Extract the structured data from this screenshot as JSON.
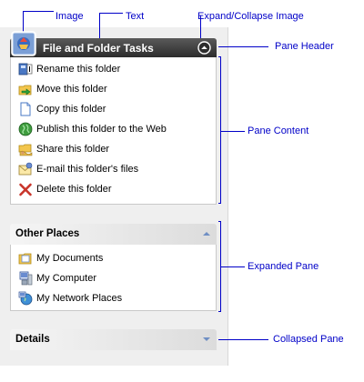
{
  "annotations": {
    "image": "Image",
    "text": "Text",
    "expand_collapse_image": "Expand/Collapse Image",
    "pane_header": "Pane Header",
    "pane_content": "Pane Content",
    "expanded_pane": "Expanded Pane",
    "collapsed_pane": "Collapsed Pane"
  },
  "panes": [
    {
      "title": "File and Folder Tasks",
      "state": "expanded",
      "items": [
        {
          "label": "Rename this folder",
          "icon": "rename-folder-icon"
        },
        {
          "label": "Move this folder",
          "icon": "move-folder-icon"
        },
        {
          "label": "Copy this folder",
          "icon": "copy-folder-icon"
        },
        {
          "label": "Publish this folder to the Web",
          "icon": "publish-web-icon"
        },
        {
          "label": "Share this folder",
          "icon": "share-folder-icon"
        },
        {
          "label": "E-mail this folder's files",
          "icon": "email-files-icon"
        },
        {
          "label": "Delete this folder",
          "icon": "delete-icon"
        }
      ]
    },
    {
      "title": "Other Places",
      "state": "expanded",
      "items": [
        {
          "label": "My Documents",
          "icon": "my-documents-icon"
        },
        {
          "label": "My Computer",
          "icon": "my-computer-icon"
        },
        {
          "label": "My Network Places",
          "icon": "network-places-icon"
        }
      ]
    },
    {
      "title": "Details",
      "state": "collapsed",
      "items": []
    }
  ],
  "colors": {
    "annotation": "#0000c8",
    "special_header": "#3a3a3a",
    "normal_header": "#dcdcdc",
    "chevron": "#6f8fc4"
  }
}
